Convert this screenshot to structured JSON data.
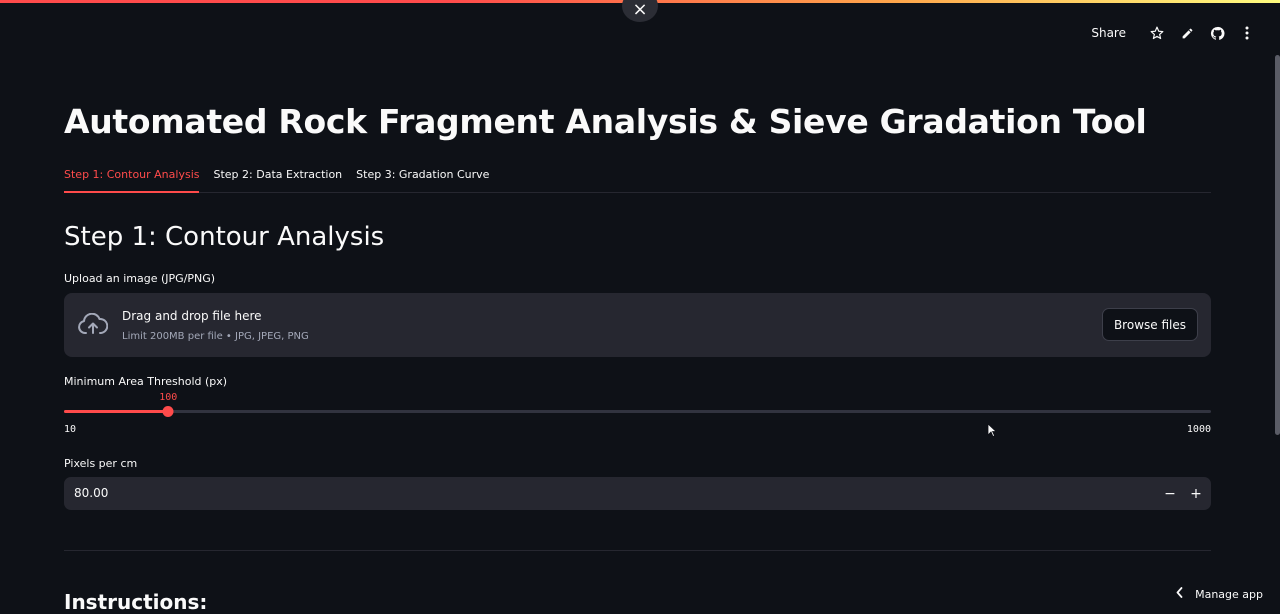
{
  "close_icon": "×",
  "toolbar": {
    "share_label": "Share",
    "icons": [
      "star-icon",
      "edit-pencil-icon",
      "github-icon",
      "more-vertical-icon"
    ]
  },
  "page": {
    "title": "Automated Rock Fragment Analysis & Sieve Gradation Tool"
  },
  "tabs": [
    {
      "label": "Step 1: Contour Analysis",
      "active": true
    },
    {
      "label": "Step 2: Data Extraction",
      "active": false
    },
    {
      "label": "Step 3: Gradation Curve",
      "active": false
    }
  ],
  "section": {
    "title": "Step 1: Contour Analysis"
  },
  "uploader": {
    "label": "Upload an image (JPG/PNG)",
    "drop_title": "Drag and drop file here",
    "drop_subtitle": "Limit 200MB per file • JPG, JPEG, PNG",
    "browse_label": "Browse files",
    "icon": "cloud-upload-icon"
  },
  "slider": {
    "label": "Minimum Area Threshold (px)",
    "value": 100,
    "value_text": "100",
    "min": 10,
    "max": 1000,
    "min_text": "10",
    "max_text": "1000"
  },
  "pixels_input": {
    "label": "Pixels per cm",
    "value": "80.00",
    "minus_label": "−",
    "plus_label": "+"
  },
  "instructions": {
    "title": "Instructions:"
  },
  "manage_app": {
    "label": "Manage app",
    "icon": "chevron-left-icon"
  },
  "colors": {
    "background": "#0e1117",
    "accent": "#ff4b4b",
    "surface": "#262730"
  }
}
